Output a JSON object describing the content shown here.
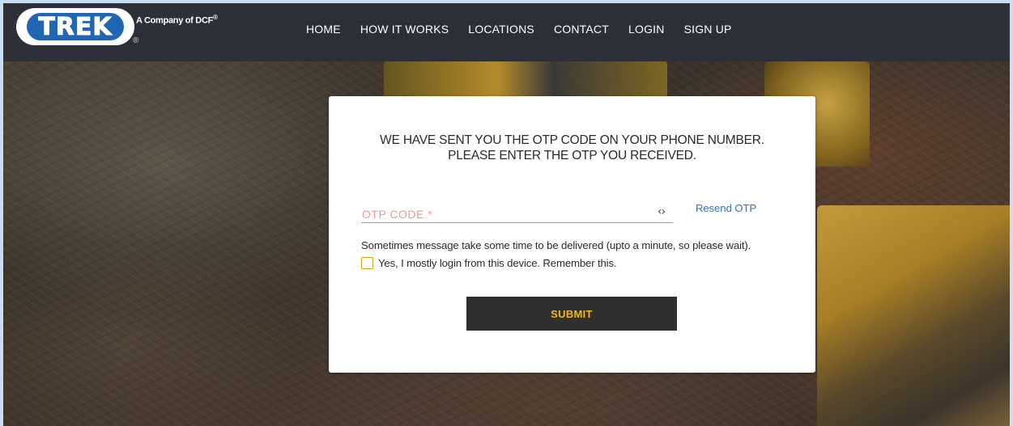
{
  "brand": {
    "logo_text": "TREK",
    "tagline": "A Company of DCF",
    "tagline_mark": "®",
    "registered_mark": "®",
    "logo_color": "#1f66b3"
  },
  "nav": {
    "items": [
      "HOME",
      "HOW IT WORKS",
      "LOCATIONS",
      "CONTACT",
      "LOGIN",
      "SIGN UP"
    ]
  },
  "otp_form": {
    "heading_line1": "WE HAVE SENT YOU THE OTP CODE ON YOUR PHONE NUMBER.",
    "heading_line2": "PLEASE ENTER THE OTP YOU RECEIVED.",
    "otp_placeholder": "OTP CODE *",
    "otp_value": "",
    "code_icon": "‹›",
    "resend_label": "Resend OTP",
    "note": "Sometimes message take some time to be delivered (upto a minute, so please wait).",
    "remember_label": "Yes, I mostly login from this device. Remember this.",
    "remember_checked": false,
    "submit_label": "SUBMIT"
  },
  "colors": {
    "navbar": "#2d3038",
    "accent": "#f2b71f",
    "link": "#2b74c1",
    "field_underline": "#e97878"
  }
}
